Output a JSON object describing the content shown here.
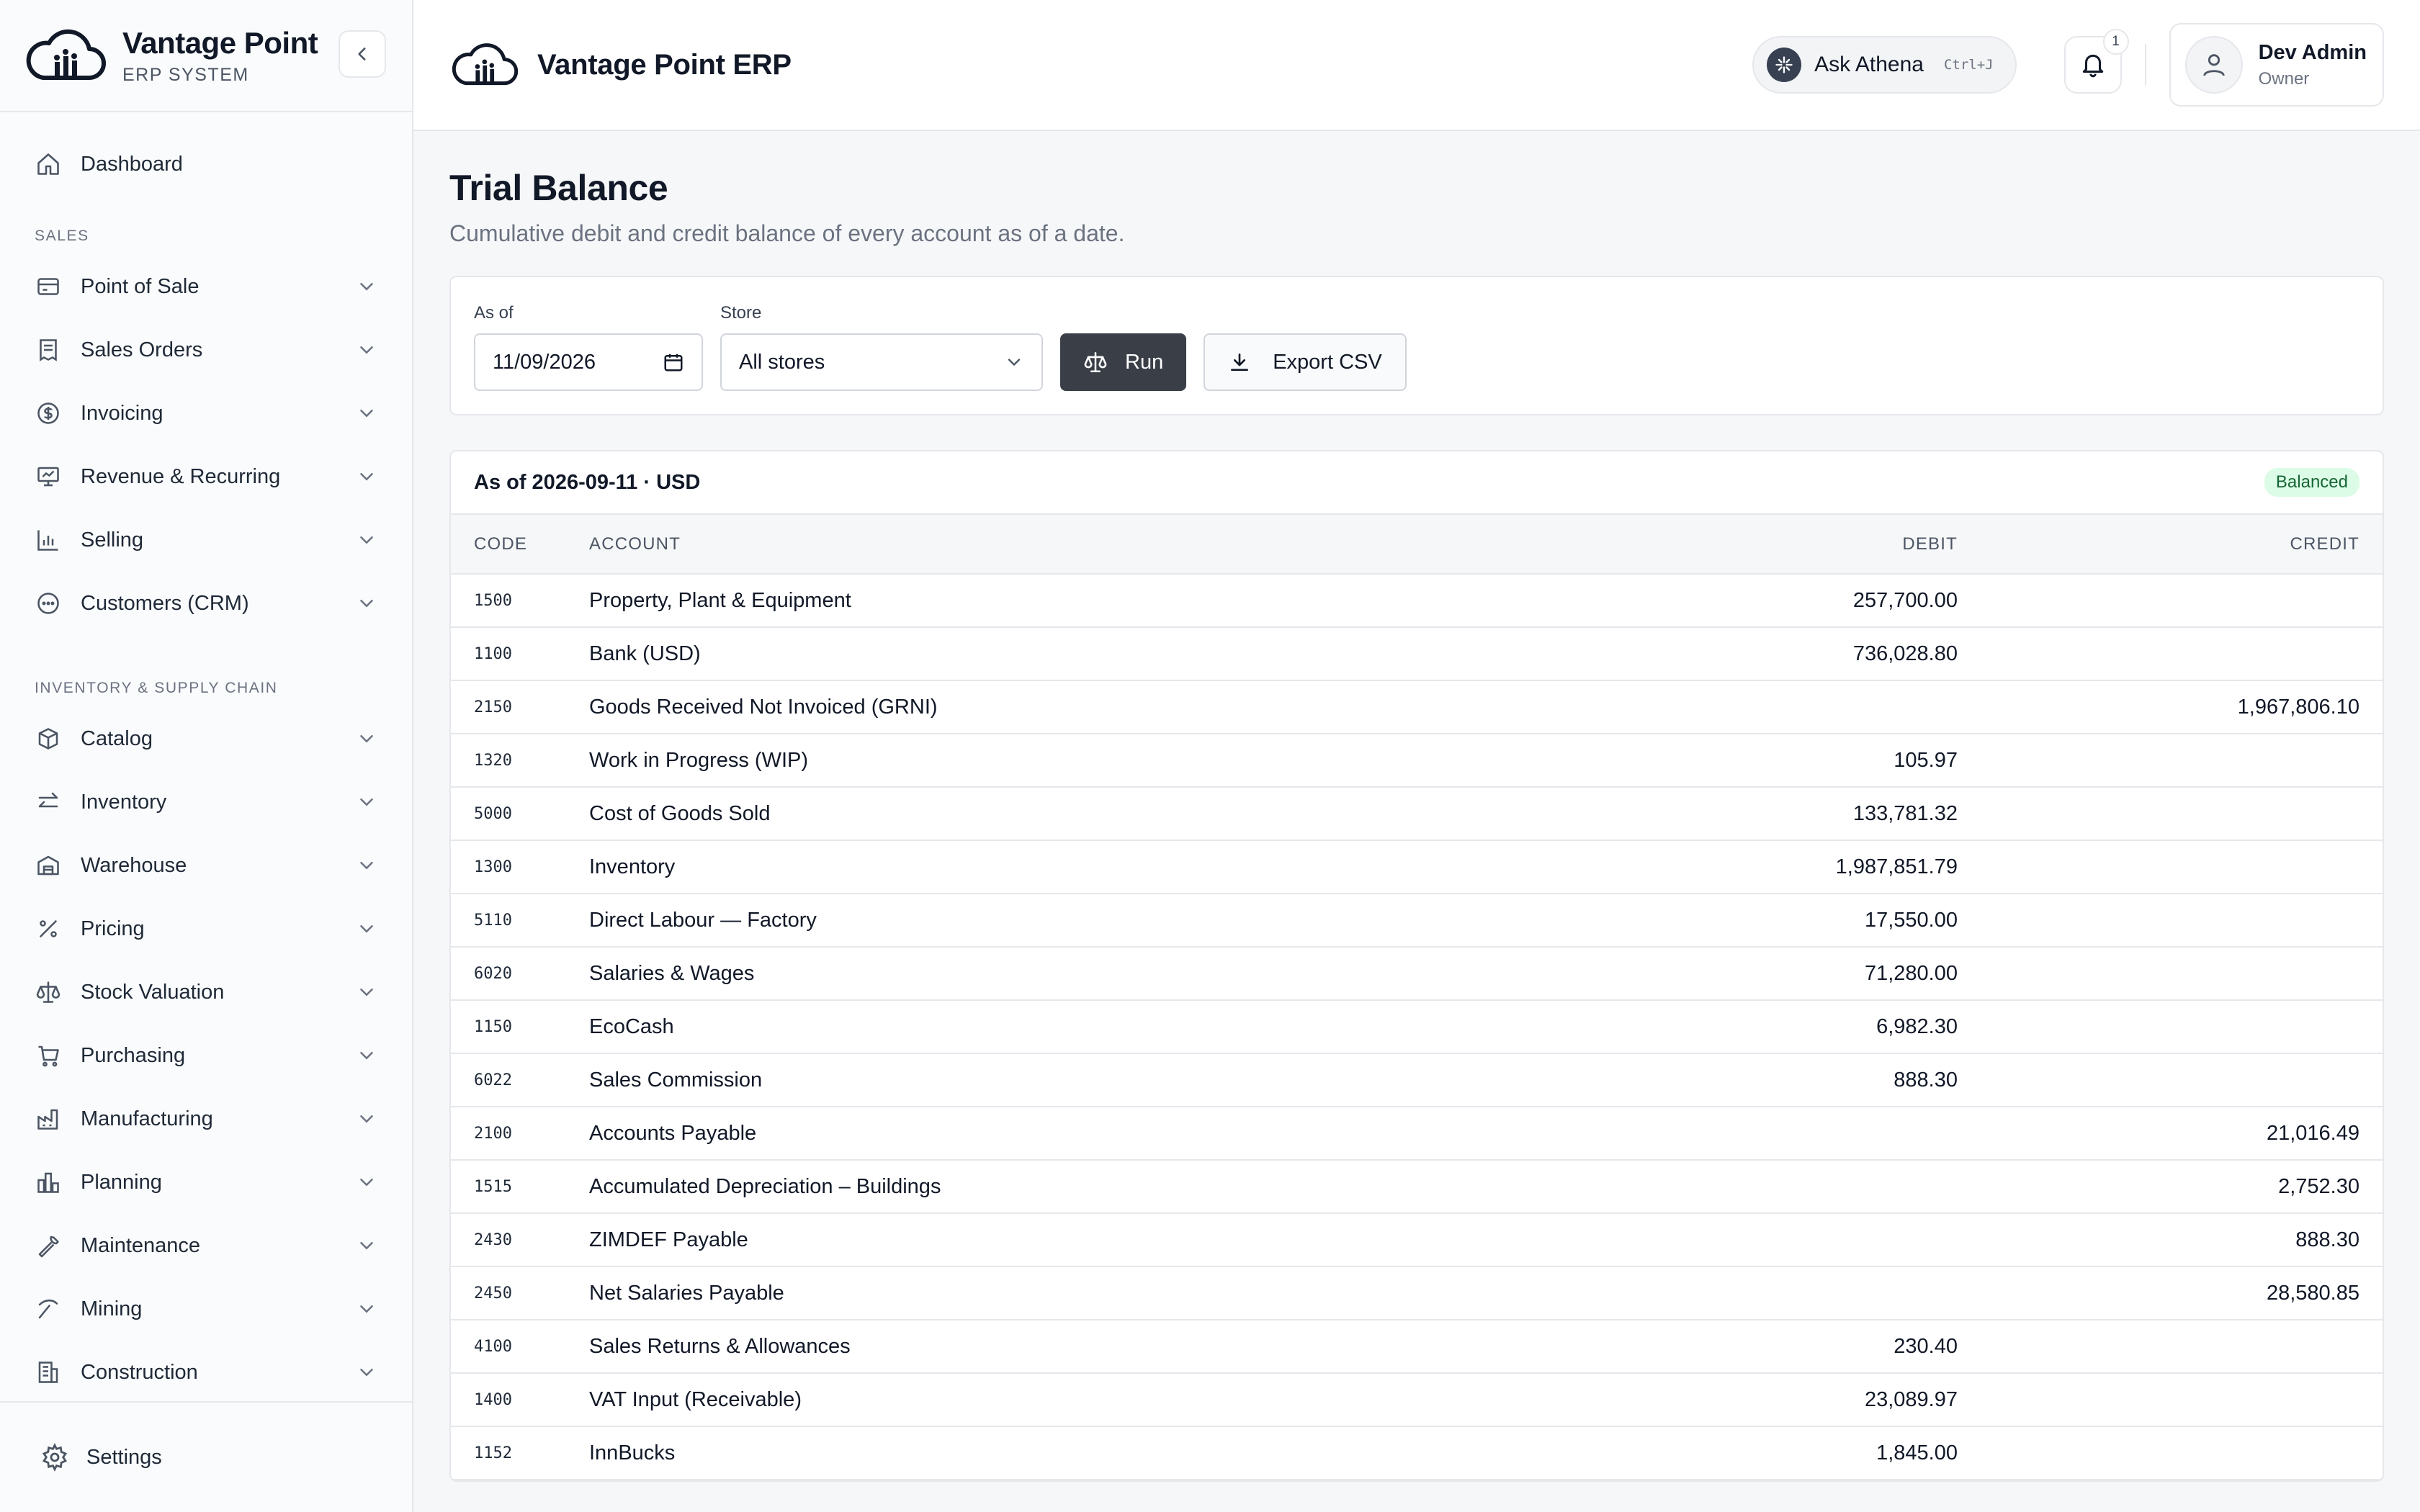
{
  "brand": {
    "name": "Vantage Point",
    "subtitle": "ERP SYSTEM"
  },
  "topbar": {
    "app_title": "Vantage Point ERP",
    "ask_label": "Ask Athena",
    "ask_shortcut": "Ctrl+J",
    "notification_count": "1",
    "user_name": "Dev Admin",
    "user_role": "Owner"
  },
  "sidebar": {
    "dashboard": "Dashboard",
    "sections": [
      {
        "title": "SALES",
        "items": [
          {
            "label": "Point of Sale",
            "icon": "pos-terminal-icon"
          },
          {
            "label": "Sales Orders",
            "icon": "receipt-icon"
          },
          {
            "label": "Invoicing",
            "icon": "dollar-circle-icon"
          },
          {
            "label": "Revenue & Recurring",
            "icon": "presentation-chart-icon"
          },
          {
            "label": "Selling",
            "icon": "bar-chart-icon"
          },
          {
            "label": "Customers (CRM)",
            "icon": "chat-bubble-icon"
          }
        ]
      },
      {
        "title": "INVENTORY & SUPPLY CHAIN",
        "items": [
          {
            "label": "Catalog",
            "icon": "box-icon"
          },
          {
            "label": "Inventory",
            "icon": "arrows-swap-icon"
          },
          {
            "label": "Warehouse",
            "icon": "warehouse-icon"
          },
          {
            "label": "Pricing",
            "icon": "percent-icon"
          },
          {
            "label": "Stock Valuation",
            "icon": "scale-icon"
          },
          {
            "label": "Purchasing",
            "icon": "cart-icon"
          },
          {
            "label": "Manufacturing",
            "icon": "factory-icon"
          },
          {
            "label": "Planning",
            "icon": "columns-chart-icon"
          },
          {
            "label": "Maintenance",
            "icon": "wrench-icon"
          },
          {
            "label": "Mining",
            "icon": "pickaxe-icon"
          },
          {
            "label": "Construction",
            "icon": "building-icon"
          }
        ]
      }
    ],
    "settings": "Settings"
  },
  "page": {
    "title": "Trial Balance",
    "subtitle": "Cumulative debit and credit balance of every account as of a date."
  },
  "filters": {
    "as_of_label": "As of",
    "as_of_value": "11/09/2026",
    "store_label": "Store",
    "store_value": "All stores",
    "run_label": "Run",
    "export_label": "Export CSV"
  },
  "report": {
    "heading": "As of 2026-09-11 · USD",
    "status": "Balanced",
    "columns": {
      "code": "CODE",
      "account": "ACCOUNT",
      "debit": "DEBIT",
      "credit": "CREDIT"
    },
    "rows": [
      {
        "code": "1500",
        "account": "Property, Plant & Equipment",
        "debit": "257,700.00",
        "credit": ""
      },
      {
        "code": "1100",
        "account": "Bank (USD)",
        "debit": "736,028.80",
        "credit": ""
      },
      {
        "code": "2150",
        "account": "Goods Received Not Invoiced (GRNI)",
        "debit": "",
        "credit": "1,967,806.10"
      },
      {
        "code": "1320",
        "account": "Work in Progress (WIP)",
        "debit": "105.97",
        "credit": ""
      },
      {
        "code": "5000",
        "account": "Cost of Goods Sold",
        "debit": "133,781.32",
        "credit": ""
      },
      {
        "code": "1300",
        "account": "Inventory",
        "debit": "1,987,851.79",
        "credit": ""
      },
      {
        "code": "5110",
        "account": "Direct Labour — Factory",
        "debit": "17,550.00",
        "credit": ""
      },
      {
        "code": "6020",
        "account": "Salaries & Wages",
        "debit": "71,280.00",
        "credit": ""
      },
      {
        "code": "1150",
        "account": "EcoCash",
        "debit": "6,982.30",
        "credit": ""
      },
      {
        "code": "6022",
        "account": "Sales Commission",
        "debit": "888.30",
        "credit": ""
      },
      {
        "code": "2100",
        "account": "Accounts Payable",
        "debit": "",
        "credit": "21,016.49"
      },
      {
        "code": "1515",
        "account": "Accumulated Depreciation – Buildings",
        "debit": "",
        "credit": "2,752.30"
      },
      {
        "code": "2430",
        "account": "ZIMDEF Payable",
        "debit": "",
        "credit": "888.30"
      },
      {
        "code": "2450",
        "account": "Net Salaries Payable",
        "debit": "",
        "credit": "28,580.85"
      },
      {
        "code": "4100",
        "account": "Sales Returns & Allowances",
        "debit": "230.40",
        "credit": ""
      },
      {
        "code": "1400",
        "account": "VAT Input (Receivable)",
        "debit": "23,089.97",
        "credit": ""
      },
      {
        "code": "1152",
        "account": "InnBucks",
        "debit": "1,845.00",
        "credit": ""
      }
    ]
  }
}
